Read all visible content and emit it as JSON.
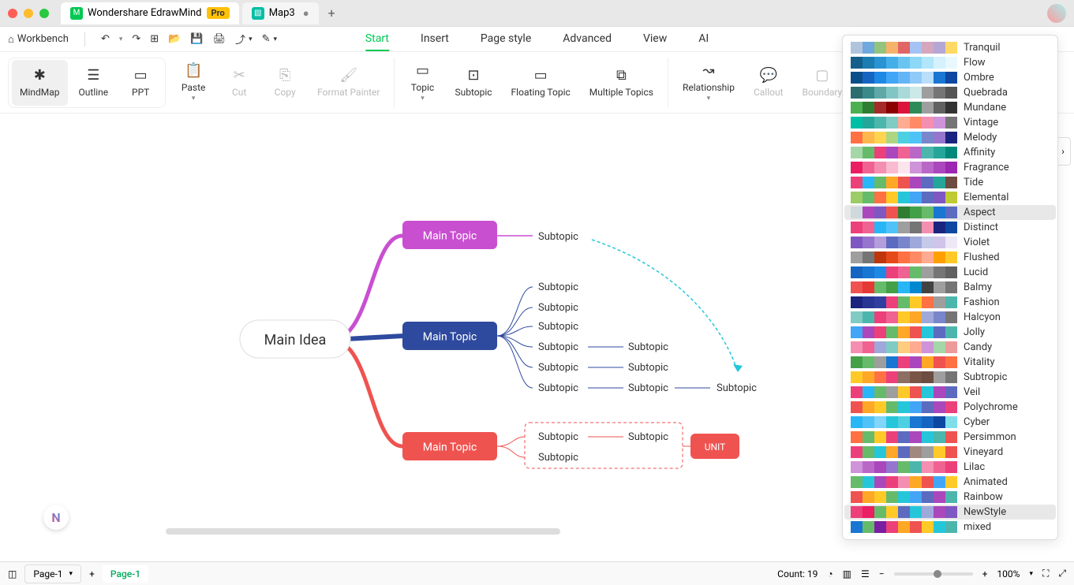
{
  "titlebar": {
    "app": "Wondershare EdrawMind",
    "badge": "Pro",
    "tab2": "Map3"
  },
  "toolbar": {
    "workbench": "Workbench"
  },
  "menu": {
    "start": "Start",
    "insert": "Insert",
    "pagestyle": "Page style",
    "advanced": "Advanced",
    "view": "View",
    "ai": "AI"
  },
  "ribbon": {
    "mindmap": "MindMap",
    "outline": "Outline",
    "ppt": "PPT",
    "paste": "Paste",
    "cut": "Cut",
    "copy": "Copy",
    "format_painter": "Format Painter",
    "topic": "Topic",
    "subtopic": "Subtopic",
    "floating": "Floating Topic",
    "multiple": "Multiple Topics",
    "relationship": "Relationship",
    "callout": "Callout",
    "boundary": "Boundary"
  },
  "mindmap": {
    "main": "Main Idea",
    "topic1": "Main Topic",
    "topic2": "Main Topic",
    "topic3": "Main Topic",
    "sub1": "Subtopic",
    "sub2a": "Subtopic",
    "sub2b": "Subtopic",
    "sub2c": "Subtopic",
    "sub2d": "Subtopic",
    "sub2e": "Subtopic",
    "sub2f": "Subtopic",
    "sub2d2": "Subtopic",
    "sub2e2": "Subtopic",
    "sub2f2": "Subtopic",
    "sub2f3": "Subtopic",
    "sub3a": "Subtopic",
    "sub3b": "Subtopic",
    "sub3a2": "Subtopic",
    "unit": "UNIT"
  },
  "status": {
    "page_sel": "Page-1",
    "page_tab": "Page-1",
    "count": "Count: 19",
    "zoom": "100%"
  },
  "themes": [
    {
      "name": "Tranquil",
      "colors": [
        "#b0c4de",
        "#6fa8dc",
        "#93c47d",
        "#f6b26b",
        "#e06666",
        "#a4c2f4",
        "#d5a6bd",
        "#b4a7d6",
        "#ffd966"
      ]
    },
    {
      "name": "Flow",
      "colors": [
        "#155f8a",
        "#1c7db0",
        "#2a93d4",
        "#45aee8",
        "#6ac4f0",
        "#8dd8f7",
        "#b2e6fb",
        "#d4f1fd",
        "#e8f8fe"
      ]
    },
    {
      "name": "Ombre",
      "colors": [
        "#0b4f8a",
        "#1565c0",
        "#1e88e5",
        "#42a5f5",
        "#64b5f6",
        "#90caf9",
        "#bbdefb",
        "#1976d2",
        "#0d47a1"
      ]
    },
    {
      "name": "Quebrada",
      "colors": [
        "#2c6e6e",
        "#3a8a8a",
        "#5fa8a8",
        "#82c5c5",
        "#a9d9d9",
        "#cce8e8",
        "#9e9e9e",
        "#757575",
        "#555"
      ]
    },
    {
      "name": "Mundane",
      "colors": [
        "#4caf50",
        "#2e7d32",
        "#a52a2a",
        "#8b0000",
        "#dc143c",
        "#2e8b57",
        "#9e9e9e",
        "#616161",
        "#333"
      ]
    },
    {
      "name": "Vintage",
      "colors": [
        "#00bfa5",
        "#26a69a",
        "#4db6ac",
        "#80cbc4",
        "#ffab91",
        "#ff8a65",
        "#f48fb1",
        "#ce93d8",
        "#757575"
      ]
    },
    {
      "name": "Melody",
      "colors": [
        "#ff7043",
        "#ffb74d",
        "#ffd54f",
        "#aed581",
        "#4dd0e1",
        "#4fc3f7",
        "#7986cb",
        "#9575cd",
        "#1a237e"
      ]
    },
    {
      "name": "Affinity",
      "colors": [
        "#a5d6a7",
        "#66bb6a",
        "#ec407a",
        "#ab47bc",
        "#f06292",
        "#ba68c8",
        "#4db6ac",
        "#26a69a",
        "#00897b"
      ]
    },
    {
      "name": "Fragrance",
      "colors": [
        "#e91e63",
        "#f06292",
        "#f48fb1",
        "#f8bbd0",
        "#fce4ec",
        "#ce93d8",
        "#ba68c8",
        "#ab47bc",
        "#9c27b0"
      ]
    },
    {
      "name": "Tide",
      "colors": [
        "#ec407a",
        "#29b6f6",
        "#66bb6a",
        "#ffa726",
        "#ef5350",
        "#ab47bc",
        "#5c6bc0",
        "#26a69a",
        "#6d4c41"
      ]
    },
    {
      "name": "Elemental",
      "colors": [
        "#9ccc65",
        "#66bb6a",
        "#ff7043",
        "#ffca28",
        "#26c6da",
        "#42a5f5",
        "#5c6bc0",
        "#7e57c2",
        "#c0ca33"
      ]
    },
    {
      "name": "Aspect",
      "colors": [
        "#cfd8dc",
        "#ab47bc",
        "#7e57c2",
        "#ef5350",
        "#2e7d32",
        "#43a047",
        "#66bb6a",
        "#1976d2",
        "#5c6bc0"
      ]
    },
    {
      "name": "Distinct",
      "colors": [
        "#ec407a",
        "#f06292",
        "#29b6f6",
        "#4fc3f7",
        "#9e9e9e",
        "#757575",
        "#f48fb1",
        "#1a237e",
        "#0d47a1"
      ]
    },
    {
      "name": "Violet",
      "colors": [
        "#7e57c2",
        "#9575cd",
        "#b39ddb",
        "#5c6bc0",
        "#7986cb",
        "#9fa8da",
        "#c5cae9",
        "#d1c4e9",
        "#ede7f6"
      ]
    },
    {
      "name": "Flushed",
      "colors": [
        "#9e9e9e",
        "#757575",
        "#bf360c",
        "#e64a19",
        "#ff7043",
        "#ff8a65",
        "#ffab91",
        "#ffa000",
        "#ffca28"
      ]
    },
    {
      "name": "Lucid",
      "colors": [
        "#1565c0",
        "#1976d2",
        "#1e88e5",
        "#ec407a",
        "#f06292",
        "#66bb6a",
        "#9e9e9e",
        "#757575",
        "#616161"
      ]
    },
    {
      "name": "Balmy",
      "colors": [
        "#ef5350",
        "#e53935",
        "#66bb6a",
        "#43a047",
        "#29b6f6",
        "#0288d1",
        "#424242",
        "#9e9e9e",
        "#757575"
      ]
    },
    {
      "name": "Fashion",
      "colors": [
        "#1a237e",
        "#283593",
        "#303f9f",
        "#ec407a",
        "#66bb6a",
        "#ffca28",
        "#ff7043",
        "#9e9e9e",
        "#4db6ac"
      ]
    },
    {
      "name": "Halcyon",
      "colors": [
        "#80cbc4",
        "#4db6ac",
        "#ec407a",
        "#f06292",
        "#ffca28",
        "#ffa726",
        "#9fa8da",
        "#7986cb",
        "#757575"
      ]
    },
    {
      "name": "Jolly",
      "colors": [
        "#42a5f5",
        "#ab47bc",
        "#ec407a",
        "#66bb6a",
        "#ffa726",
        "#ef5350",
        "#26c6da",
        "#5c6bc0",
        "#4db6ac"
      ]
    },
    {
      "name": "Candy",
      "colors": [
        "#f48fb1",
        "#f06292",
        "#9fa8da",
        "#80cbc4",
        "#ffcc80",
        "#ffab91",
        "#ce93d8",
        "#a5d6a7",
        "#ef9a9a"
      ]
    },
    {
      "name": "Vitality",
      "colors": [
        "#43a047",
        "#66bb6a",
        "#9e9e9e",
        "#1976d2",
        "#ec407a",
        "#ab47bc",
        "#ffa726",
        "#ef5350",
        "#ff7043"
      ]
    },
    {
      "name": "Subtropic",
      "colors": [
        "#ffca28",
        "#ffa726",
        "#ff7043",
        "#ec407a",
        "#8d6e63",
        "#795548",
        "#6d4c41",
        "#9e9e9e",
        "#757575"
      ]
    },
    {
      "name": "Veil",
      "colors": [
        "#ec407a",
        "#29b6f6",
        "#66bb6a",
        "#9e9e9e",
        "#ffca28",
        "#ef5350",
        "#26c6da",
        "#ab47bc",
        "#5c6bc0"
      ]
    },
    {
      "name": "Polychrome",
      "colors": [
        "#ef5350",
        "#ffa726",
        "#ffca28",
        "#66bb6a",
        "#26c6da",
        "#42a5f5",
        "#5c6bc0",
        "#ab47bc",
        "#ec407a"
      ]
    },
    {
      "name": "Cyber",
      "colors": [
        "#29b6f6",
        "#4fc3f7",
        "#81d4fa",
        "#26c6da",
        "#4dd0e1",
        "#1976d2",
        "#1565c0",
        "#0d47a1",
        "#80deea"
      ]
    },
    {
      "name": "Persimmon",
      "colors": [
        "#ff7043",
        "#66bb6a",
        "#ffca28",
        "#ec407a",
        "#5c6bc0",
        "#ab47bc",
        "#26c6da",
        "#4db6ac",
        "#ef5350"
      ]
    },
    {
      "name": "Vineyard",
      "colors": [
        "#ec407a",
        "#66bb6a",
        "#26c6da",
        "#ffa726",
        "#5c6bc0",
        "#a1887f",
        "#9e9e9e",
        "#ffca28",
        "#ef5350"
      ]
    },
    {
      "name": "Lilac",
      "colors": [
        "#ce93d8",
        "#ba68c8",
        "#ab47bc",
        "#9575cd",
        "#66bb6a",
        "#4db6ac",
        "#f48fb1",
        "#f06292",
        "#ec407a"
      ]
    },
    {
      "name": "Animated",
      "colors": [
        "#66bb6a",
        "#26c6da",
        "#ab47bc",
        "#ec407a",
        "#f48fb1",
        "#ffa726",
        "#ef5350",
        "#42a5f5",
        "#ffca28"
      ]
    },
    {
      "name": "Rainbow",
      "colors": [
        "#ef5350",
        "#ffa726",
        "#ffca28",
        "#66bb6a",
        "#26c6da",
        "#42a5f5",
        "#5c6bc0",
        "#ab47bc",
        "#4db6ac"
      ]
    },
    {
      "name": "NewStyle",
      "colors": [
        "#ec407a",
        "#e91e63",
        "#66bb6a",
        "#ffca28",
        "#5c6bc0",
        "#26c6da",
        "#9fa8da",
        "#ab47bc",
        "#7e57c2"
      ]
    },
    {
      "name": "mixed",
      "colors": [
        "#1976d2",
        "#66bb6a",
        "#7b1fa2",
        "#ec407a",
        "#ffa726",
        "#ef5350",
        "#ffca28",
        "#26c6da",
        "#4db6ac"
      ]
    }
  ],
  "theme_selected": "Aspect",
  "theme_highlighted": "NewStyle"
}
